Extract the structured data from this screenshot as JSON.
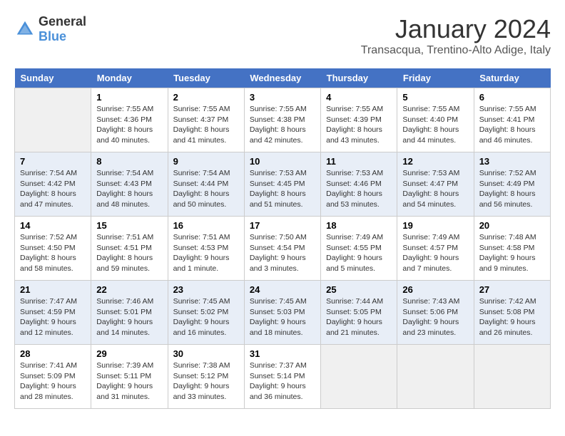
{
  "header": {
    "logo_general": "General",
    "logo_blue": "Blue",
    "month": "January 2024",
    "location": "Transacqua, Trentino-Alto Adige, Italy"
  },
  "weekdays": [
    "Sunday",
    "Monday",
    "Tuesday",
    "Wednesday",
    "Thursday",
    "Friday",
    "Saturday"
  ],
  "weeks": [
    [
      {
        "day": "",
        "info": ""
      },
      {
        "day": "1",
        "info": "Sunrise: 7:55 AM\nSunset: 4:36 PM\nDaylight: 8 hours\nand 40 minutes."
      },
      {
        "day": "2",
        "info": "Sunrise: 7:55 AM\nSunset: 4:37 PM\nDaylight: 8 hours\nand 41 minutes."
      },
      {
        "day": "3",
        "info": "Sunrise: 7:55 AM\nSunset: 4:38 PM\nDaylight: 8 hours\nand 42 minutes."
      },
      {
        "day": "4",
        "info": "Sunrise: 7:55 AM\nSunset: 4:39 PM\nDaylight: 8 hours\nand 43 minutes."
      },
      {
        "day": "5",
        "info": "Sunrise: 7:55 AM\nSunset: 4:40 PM\nDaylight: 8 hours\nand 44 minutes."
      },
      {
        "day": "6",
        "info": "Sunrise: 7:55 AM\nSunset: 4:41 PM\nDaylight: 8 hours\nand 46 minutes."
      }
    ],
    [
      {
        "day": "7",
        "info": "Sunrise: 7:54 AM\nSunset: 4:42 PM\nDaylight: 8 hours\nand 47 minutes."
      },
      {
        "day": "8",
        "info": "Sunrise: 7:54 AM\nSunset: 4:43 PM\nDaylight: 8 hours\nand 48 minutes."
      },
      {
        "day": "9",
        "info": "Sunrise: 7:54 AM\nSunset: 4:44 PM\nDaylight: 8 hours\nand 50 minutes."
      },
      {
        "day": "10",
        "info": "Sunrise: 7:53 AM\nSunset: 4:45 PM\nDaylight: 8 hours\nand 51 minutes."
      },
      {
        "day": "11",
        "info": "Sunrise: 7:53 AM\nSunset: 4:46 PM\nDaylight: 8 hours\nand 53 minutes."
      },
      {
        "day": "12",
        "info": "Sunrise: 7:53 AM\nSunset: 4:47 PM\nDaylight: 8 hours\nand 54 minutes."
      },
      {
        "day": "13",
        "info": "Sunrise: 7:52 AM\nSunset: 4:49 PM\nDaylight: 8 hours\nand 56 minutes."
      }
    ],
    [
      {
        "day": "14",
        "info": "Sunrise: 7:52 AM\nSunset: 4:50 PM\nDaylight: 8 hours\nand 58 minutes."
      },
      {
        "day": "15",
        "info": "Sunrise: 7:51 AM\nSunset: 4:51 PM\nDaylight: 8 hours\nand 59 minutes."
      },
      {
        "day": "16",
        "info": "Sunrise: 7:51 AM\nSunset: 4:53 PM\nDaylight: 9 hours\nand 1 minute."
      },
      {
        "day": "17",
        "info": "Sunrise: 7:50 AM\nSunset: 4:54 PM\nDaylight: 9 hours\nand 3 minutes."
      },
      {
        "day": "18",
        "info": "Sunrise: 7:49 AM\nSunset: 4:55 PM\nDaylight: 9 hours\nand 5 minutes."
      },
      {
        "day": "19",
        "info": "Sunrise: 7:49 AM\nSunset: 4:57 PM\nDaylight: 9 hours\nand 7 minutes."
      },
      {
        "day": "20",
        "info": "Sunrise: 7:48 AM\nSunset: 4:58 PM\nDaylight: 9 hours\nand 9 minutes."
      }
    ],
    [
      {
        "day": "21",
        "info": "Sunrise: 7:47 AM\nSunset: 4:59 PM\nDaylight: 9 hours\nand 12 minutes."
      },
      {
        "day": "22",
        "info": "Sunrise: 7:46 AM\nSunset: 5:01 PM\nDaylight: 9 hours\nand 14 minutes."
      },
      {
        "day": "23",
        "info": "Sunrise: 7:45 AM\nSunset: 5:02 PM\nDaylight: 9 hours\nand 16 minutes."
      },
      {
        "day": "24",
        "info": "Sunrise: 7:45 AM\nSunset: 5:03 PM\nDaylight: 9 hours\nand 18 minutes."
      },
      {
        "day": "25",
        "info": "Sunrise: 7:44 AM\nSunset: 5:05 PM\nDaylight: 9 hours\nand 21 minutes."
      },
      {
        "day": "26",
        "info": "Sunrise: 7:43 AM\nSunset: 5:06 PM\nDaylight: 9 hours\nand 23 minutes."
      },
      {
        "day": "27",
        "info": "Sunrise: 7:42 AM\nSunset: 5:08 PM\nDaylight: 9 hours\nand 26 minutes."
      }
    ],
    [
      {
        "day": "28",
        "info": "Sunrise: 7:41 AM\nSunset: 5:09 PM\nDaylight: 9 hours\nand 28 minutes."
      },
      {
        "day": "29",
        "info": "Sunrise: 7:39 AM\nSunset: 5:11 PM\nDaylight: 9 hours\nand 31 minutes."
      },
      {
        "day": "30",
        "info": "Sunrise: 7:38 AM\nSunset: 5:12 PM\nDaylight: 9 hours\nand 33 minutes."
      },
      {
        "day": "31",
        "info": "Sunrise: 7:37 AM\nSunset: 5:14 PM\nDaylight: 9 hours\nand 36 minutes."
      },
      {
        "day": "",
        "info": ""
      },
      {
        "day": "",
        "info": ""
      },
      {
        "day": "",
        "info": ""
      }
    ]
  ]
}
